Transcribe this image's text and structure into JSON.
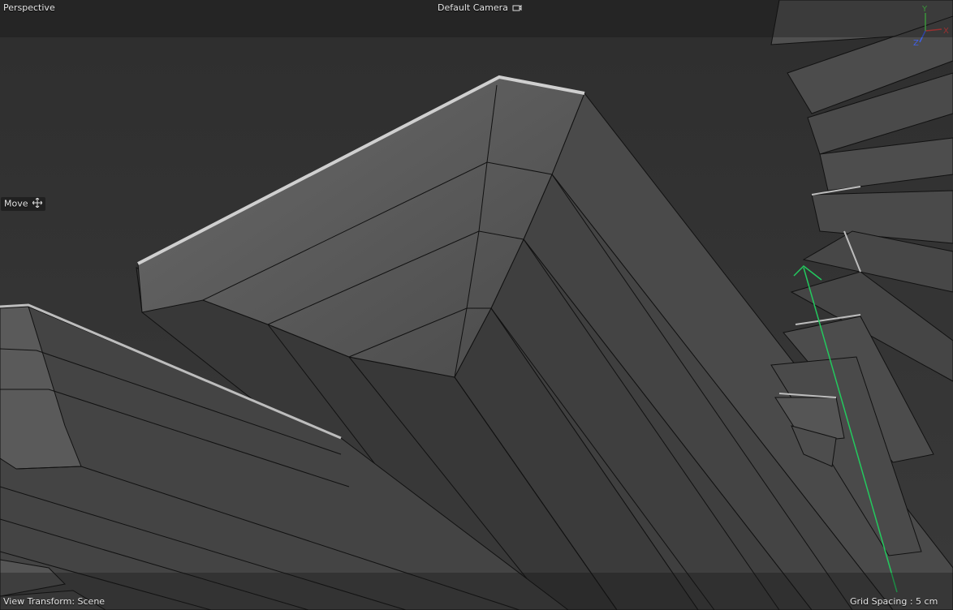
{
  "viewport": {
    "view_label": "Perspective",
    "camera_label": "Default Camera",
    "camera_icon": "camera-icon",
    "tool_label": "Move",
    "tool_icon": "move-icon",
    "transform_label": "View Transform: Scene",
    "grid_label": "Grid Spacing : 5 cm",
    "axis_labels": {
      "x": "X",
      "y": "Y",
      "z": "Z"
    },
    "colors": {
      "background": "#333333",
      "x_axis": "#e04040",
      "y_axis": "#4fdc4f",
      "z_axis": "#4060e8",
      "selection": "#23c95e"
    }
  }
}
